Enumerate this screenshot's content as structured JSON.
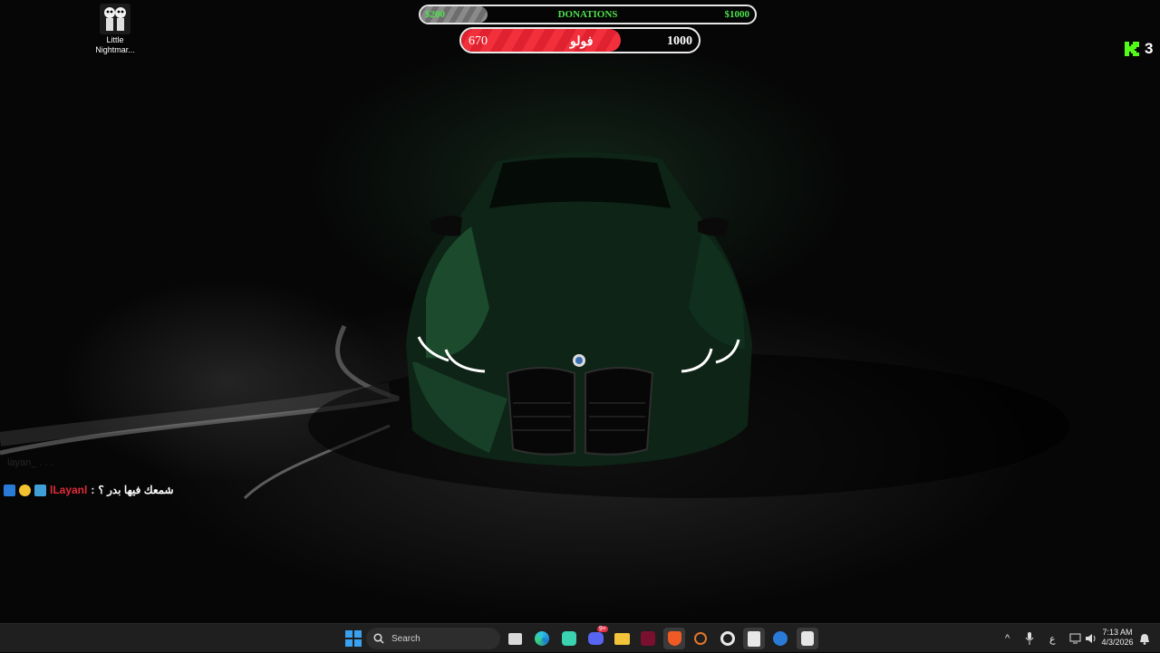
{
  "desktop": {
    "icons": [
      {
        "label": "Little Nightmar..."
      }
    ]
  },
  "donations": {
    "min": "$200",
    "title": "DONATIONS",
    "max": "$1000",
    "progress_fraction": 0.2,
    "fill_color": "#7a7a7a",
    "text_color": "#4ce34c"
  },
  "follow_goal": {
    "current": "670",
    "label": "فولو",
    "goal": "1000",
    "progress_fraction": 0.67,
    "fill_color": "#e8232f"
  },
  "kick": {
    "count": "3",
    "color": "#53fc18",
    "icon": "kick-logo-icon"
  },
  "chat": {
    "faded_line": "layan_ . . .",
    "messages": [
      {
        "user": "lLayanl",
        "separator": ":",
        "text": "شمعك فيها بدر ؟",
        "user_color": "#e02b3a",
        "badges": [
          "moderator-badge-icon",
          "founder-badge-icon",
          "subscriber-badge-icon"
        ]
      }
    ]
  },
  "taskbar": {
    "search_placeholder": "Search",
    "apps": [
      "windows-start-icon",
      "file-manager-icon",
      "edge-icon",
      "chat-app-icon",
      "discord-icon",
      "folder-icon",
      "affinity-icon",
      "brave-icon",
      "stream-tool-icon",
      "obs-icon",
      "epic-games-icon",
      "steam-icon",
      "little-nightmares-icon"
    ],
    "discord_badge": "9+",
    "tray": {
      "chevron": "^",
      "mic_icon": "microphone-icon",
      "lang": "ع",
      "network_icon": "network-icon",
      "volume_icon": "volume-icon"
    },
    "clock": {
      "time": "7:13 AM",
      "date": "4/3/2026"
    },
    "notification_icon": "notification-bell-icon"
  }
}
